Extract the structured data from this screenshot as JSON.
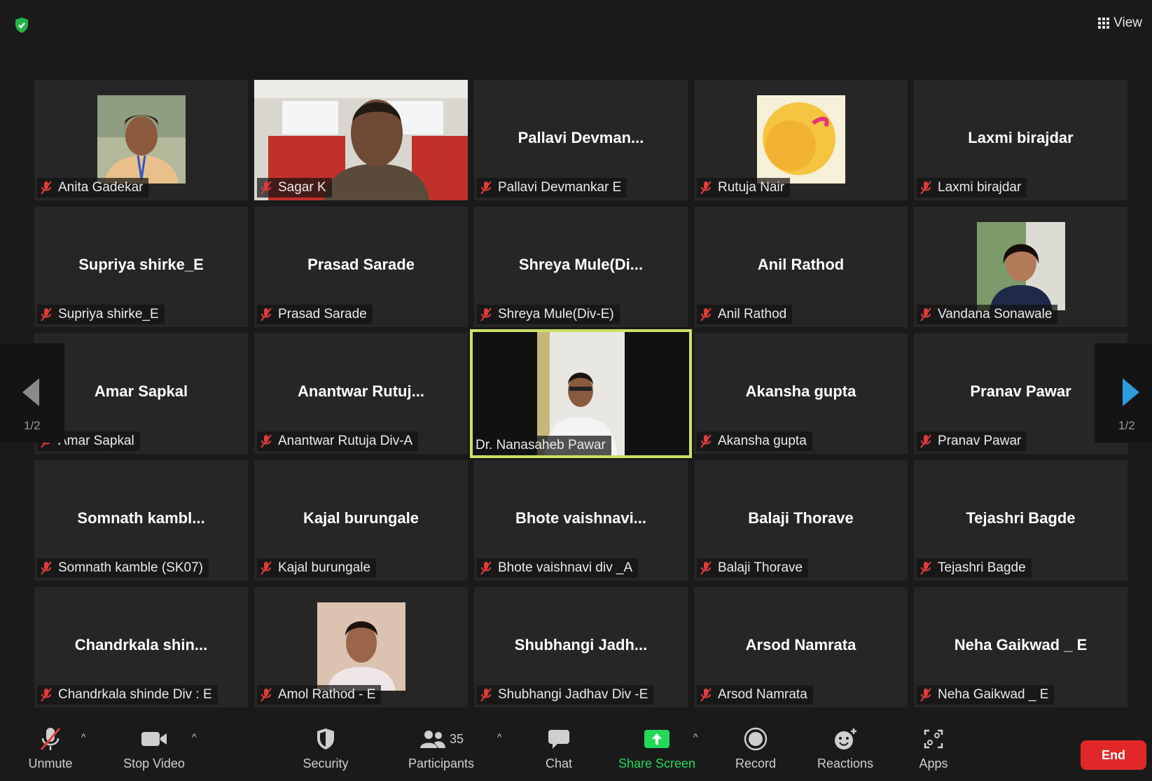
{
  "header": {
    "view_label": "View"
  },
  "tiles": [
    {
      "big": "",
      "label": "Anita Gadekar"
    },
    {
      "big": "",
      "label": "Sagar K"
    },
    {
      "big": "Pallavi  Devman...",
      "label": "Pallavi Devmankar E"
    },
    {
      "big": "",
      "label": "Rutuja Nair"
    },
    {
      "big": "Laxmi birajdar",
      "label": "Laxmi birajdar"
    },
    {
      "big": "Supriya shirke_E",
      "label": "Supriya shirke_E"
    },
    {
      "big": "Prasad Sarade",
      "label": "Prasad Sarade"
    },
    {
      "big": "Shreya  Mule(Di...",
      "label": "Shreya Mule(Div-E)"
    },
    {
      "big": "Anil Rathod",
      "label": "Anil Rathod"
    },
    {
      "big": "",
      "label": "Vandana Sonawale"
    },
    {
      "big": "Amar Sapkal",
      "label": "Amar Sapkal"
    },
    {
      "big": "Anantwar  Rutuj...",
      "label": "Anantwar Rutuja Div-A"
    },
    {
      "big": "",
      "label": "Dr. Nanasaheb Pawar"
    },
    {
      "big": "Akansha gupta",
      "label": "Akansha gupta"
    },
    {
      "big": "Pranav Pawar",
      "label": "Pranav Pawar"
    },
    {
      "big": "Somnath  kambl...",
      "label": "Somnath kamble (SK07)"
    },
    {
      "big": "Kajal burungale",
      "label": "Kajal burungale"
    },
    {
      "big": "Bhote  vaishnavi...",
      "label": "Bhote vaishnavi div _A"
    },
    {
      "big": "Balaji Thorave",
      "label": "Balaji Thorave"
    },
    {
      "big": "Tejashri Bagde",
      "label": "Tejashri Bagde"
    },
    {
      "big": "Chandrkala  shin...",
      "label": "Chandrkala shinde Div : E"
    },
    {
      "big": "",
      "label": "Amol Rathod - E"
    },
    {
      "big": "Shubhangi  Jadh...",
      "label": "Shubhangi Jadhav Div -E"
    },
    {
      "big": "Arsod Namrata",
      "label": "Arsod Namrata"
    },
    {
      "big": "Neha Gaikwad _ E",
      "label": "Neha Gaikwad _ E"
    }
  ],
  "pager": {
    "left": "1/2",
    "right": "1/2"
  },
  "toolbar": {
    "unmute": "Unmute",
    "stop_video": "Stop Video",
    "security": "Security",
    "participants": "Participants",
    "participants_count": "35",
    "chat": "Chat",
    "share_screen": "Share Screen",
    "record": "Record",
    "reactions": "Reactions",
    "apps": "Apps",
    "end": "End"
  },
  "colors": {
    "share": "#23d959",
    "end": "#e02828",
    "active_border": "#c9e265",
    "nav_arrow": "#2d9cdb"
  }
}
